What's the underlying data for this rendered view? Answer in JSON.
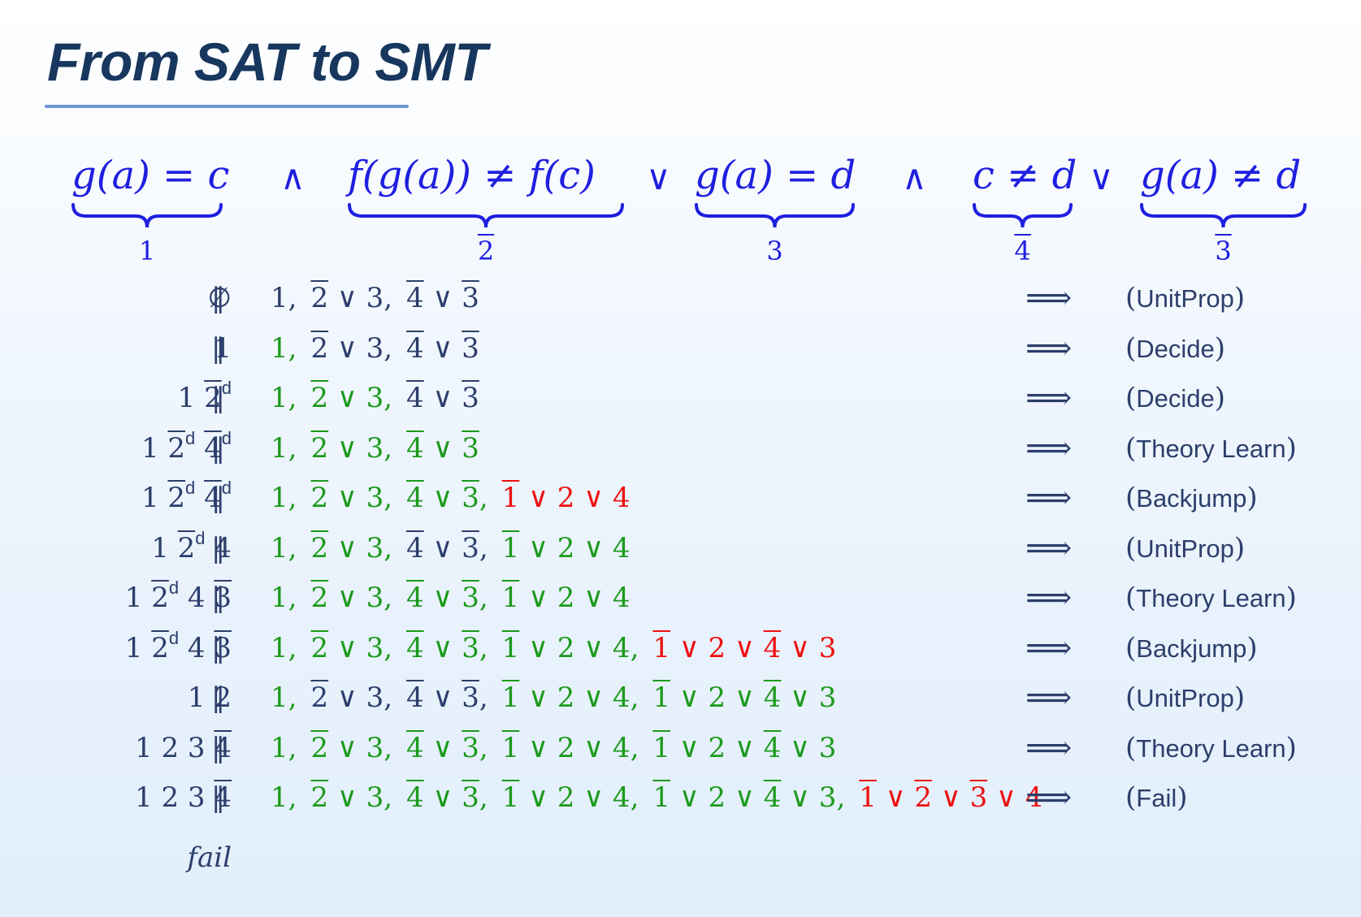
{
  "title": "From SAT to SMT",
  "formula": {
    "segments": [
      {
        "tex": "g(a) = c",
        "label": "1",
        "label_bar": false
      },
      {
        "tex": "f(g(a)) ≠ f(c)",
        "label": "2",
        "label_bar": true
      },
      {
        "tex": "g(a) = d",
        "label": "3",
        "label_bar": false
      },
      {
        "tex": "c ≠ d",
        "label": "4",
        "label_bar": true
      },
      {
        "tex": "g(a) ≠ d",
        "label": "3",
        "label_bar": true
      }
    ],
    "operators": [
      "∧",
      "∨",
      "∧",
      "∨"
    ]
  },
  "separator": "‖",
  "arrow": "⟹",
  "rows": [
    {
      "trail": [
        {
          "t": "∅"
        }
      ],
      "clauses": [
        {
          "c": "base",
          "p": [
            {
              "t": "1"
            }
          ]
        },
        {
          "c": "base",
          "p": [
            {
              "t": "2",
              "bar": true
            },
            {
              "t": " ∨ 3"
            }
          ]
        },
        {
          "c": "base",
          "p": [
            {
              "t": "4",
              "bar": true
            },
            {
              "t": " ∨ "
            },
            {
              "t": "3",
              "bar": true
            }
          ]
        }
      ],
      "rule": "UnitProp"
    },
    {
      "trail": [
        {
          "t": "1"
        }
      ],
      "clauses": [
        {
          "c": "green",
          "p": [
            {
              "t": "1"
            }
          ]
        },
        {
          "c": "base",
          "p": [
            {
              "t": "2",
              "bar": true
            },
            {
              "t": " ∨ 3"
            }
          ]
        },
        {
          "c": "base",
          "p": [
            {
              "t": "4",
              "bar": true
            },
            {
              "t": " ∨ "
            },
            {
              "t": "3",
              "bar": true
            }
          ]
        }
      ],
      "rule": "Decide"
    },
    {
      "trail": [
        {
          "t": "1 "
        },
        {
          "t": "2",
          "bar": true,
          "d": true
        }
      ],
      "clauses": [
        {
          "c": "green",
          "p": [
            {
              "t": "1"
            }
          ]
        },
        {
          "c": "green",
          "p": [
            {
              "t": "2",
              "bar": true
            },
            {
              "t": " ∨ 3"
            }
          ]
        },
        {
          "c": "base",
          "p": [
            {
              "t": "4",
              "bar": true
            },
            {
              "t": " ∨ "
            },
            {
              "t": "3",
              "bar": true
            }
          ]
        }
      ],
      "rule": "Decide"
    },
    {
      "trail": [
        {
          "t": "1 "
        },
        {
          "t": "2",
          "bar": true,
          "d": true
        },
        {
          "t": " "
        },
        {
          "t": "4",
          "bar": true,
          "d": true
        }
      ],
      "clauses": [
        {
          "c": "green",
          "p": [
            {
              "t": "1"
            }
          ]
        },
        {
          "c": "green",
          "p": [
            {
              "t": "2",
              "bar": true
            },
            {
              "t": " ∨ 3"
            }
          ]
        },
        {
          "c": "green",
          "p": [
            {
              "t": "4",
              "bar": true
            },
            {
              "t": " ∨ "
            },
            {
              "t": "3",
              "bar": true
            }
          ]
        }
      ],
      "rule": "Theory Learn"
    },
    {
      "trail": [
        {
          "t": "1 "
        },
        {
          "t": "2",
          "bar": true,
          "d": true
        },
        {
          "t": " "
        },
        {
          "t": "4",
          "bar": true,
          "d": true
        }
      ],
      "clauses": [
        {
          "c": "green",
          "p": [
            {
              "t": "1"
            }
          ]
        },
        {
          "c": "green",
          "p": [
            {
              "t": "2",
              "bar": true
            },
            {
              "t": " ∨ 3"
            }
          ]
        },
        {
          "c": "green",
          "p": [
            {
              "t": "4",
              "bar": true
            },
            {
              "t": " ∨ "
            },
            {
              "t": "3",
              "bar": true
            }
          ]
        },
        {
          "c": "red",
          "p": [
            {
              "t": "1",
              "bar": true
            },
            {
              "t": " ∨ 2 ∨ 4"
            }
          ]
        }
      ],
      "rule": "Backjump"
    },
    {
      "trail": [
        {
          "t": "1 "
        },
        {
          "t": "2",
          "bar": true,
          "d": true
        },
        {
          "t": " 4"
        }
      ],
      "clauses": [
        {
          "c": "green",
          "p": [
            {
              "t": "1"
            }
          ]
        },
        {
          "c": "green",
          "p": [
            {
              "t": "2",
              "bar": true
            },
            {
              "t": " ∨ 3"
            }
          ]
        },
        {
          "c": "base",
          "p": [
            {
              "t": "4",
              "bar": true
            },
            {
              "t": " ∨ "
            },
            {
              "t": "3",
              "bar": true
            }
          ]
        },
        {
          "c": "green",
          "p": [
            {
              "t": "1",
              "bar": true
            },
            {
              "t": " ∨ 2 ∨ 4"
            }
          ]
        }
      ],
      "rule": "UnitProp"
    },
    {
      "trail": [
        {
          "t": "1 "
        },
        {
          "t": "2",
          "bar": true,
          "d": true
        },
        {
          "t": " 4 "
        },
        {
          "t": "3",
          "bar": true
        }
      ],
      "clauses": [
        {
          "c": "green",
          "p": [
            {
              "t": "1"
            }
          ]
        },
        {
          "c": "green",
          "p": [
            {
              "t": "2",
              "bar": true
            },
            {
              "t": " ∨ 3"
            }
          ]
        },
        {
          "c": "green",
          "p": [
            {
              "t": "4",
              "bar": true
            },
            {
              "t": " ∨ "
            },
            {
              "t": "3",
              "bar": true
            }
          ]
        },
        {
          "c": "green",
          "p": [
            {
              "t": "1",
              "bar": true
            },
            {
              "t": " ∨ 2 ∨ 4"
            }
          ]
        }
      ],
      "rule": "Theory Learn"
    },
    {
      "trail": [
        {
          "t": "1 "
        },
        {
          "t": "2",
          "bar": true,
          "d": true
        },
        {
          "t": " 4 "
        },
        {
          "t": "3",
          "bar": true
        }
      ],
      "clauses": [
        {
          "c": "green",
          "p": [
            {
              "t": "1"
            }
          ]
        },
        {
          "c": "green",
          "p": [
            {
              "t": "2",
              "bar": true
            },
            {
              "t": " ∨ 3"
            }
          ]
        },
        {
          "c": "green",
          "p": [
            {
              "t": "4",
              "bar": true
            },
            {
              "t": " ∨ "
            },
            {
              "t": "3",
              "bar": true
            }
          ]
        },
        {
          "c": "green",
          "p": [
            {
              "t": "1",
              "bar": true
            },
            {
              "t": " ∨ 2 ∨ 4"
            }
          ]
        },
        {
          "c": "red",
          "p": [
            {
              "t": "1",
              "bar": true
            },
            {
              "t": " ∨ 2 ∨ "
            },
            {
              "t": "4",
              "bar": true
            },
            {
              "t": " ∨ 3"
            }
          ]
        }
      ],
      "rule": "Backjump"
    },
    {
      "trail": [
        {
          "t": "1 2"
        }
      ],
      "clauses": [
        {
          "c": "green",
          "p": [
            {
              "t": "1"
            }
          ]
        },
        {
          "c": "base",
          "p": [
            {
              "t": "2",
              "bar": true
            },
            {
              "t": " ∨ 3"
            }
          ]
        },
        {
          "c": "base",
          "p": [
            {
              "t": "4",
              "bar": true
            },
            {
              "t": " ∨ "
            },
            {
              "t": "3",
              "bar": true
            }
          ]
        },
        {
          "c": "green",
          "p": [
            {
              "t": "1",
              "bar": true
            },
            {
              "t": " ∨ 2 ∨ 4"
            }
          ]
        },
        {
          "c": "green",
          "p": [
            {
              "t": "1",
              "bar": true
            },
            {
              "t": " ∨ 2 ∨ "
            },
            {
              "t": "4",
              "bar": true
            },
            {
              "t": " ∨ 3"
            }
          ]
        }
      ],
      "rule": "UnitProp"
    },
    {
      "trail": [
        {
          "t": "1 2 3 "
        },
        {
          "t": "4",
          "bar": true
        }
      ],
      "clauses": [
        {
          "c": "green",
          "p": [
            {
              "t": "1"
            }
          ]
        },
        {
          "c": "green",
          "p": [
            {
              "t": "2",
              "bar": true
            },
            {
              "t": " ∨ 3"
            }
          ]
        },
        {
          "c": "green",
          "p": [
            {
              "t": "4",
              "bar": true
            },
            {
              "t": " ∨ "
            },
            {
              "t": "3",
              "bar": true
            }
          ]
        },
        {
          "c": "green",
          "p": [
            {
              "t": "1",
              "bar": true
            },
            {
              "t": " ∨ 2 ∨ 4"
            }
          ]
        },
        {
          "c": "green",
          "p": [
            {
              "t": "1",
              "bar": true
            },
            {
              "t": " ∨ 2 ∨ "
            },
            {
              "t": "4",
              "bar": true
            },
            {
              "t": " ∨ 3"
            }
          ]
        }
      ],
      "rule": "Theory Learn"
    },
    {
      "trail": [
        {
          "t": "1 2 3 "
        },
        {
          "t": "4",
          "bar": true
        }
      ],
      "clauses": [
        {
          "c": "green",
          "p": [
            {
              "t": "1"
            }
          ]
        },
        {
          "c": "green",
          "p": [
            {
              "t": "2",
              "bar": true
            },
            {
              "t": " ∨ 3"
            }
          ]
        },
        {
          "c": "green",
          "p": [
            {
              "t": "4",
              "bar": true
            },
            {
              "t": " ∨ "
            },
            {
              "t": "3",
              "bar": true
            }
          ]
        },
        {
          "c": "green",
          "p": [
            {
              "t": "1",
              "bar": true
            },
            {
              "t": " ∨ 2 ∨ 4"
            }
          ]
        },
        {
          "c": "green",
          "p": [
            {
              "t": "1",
              "bar": true
            },
            {
              "t": " ∨ 2 ∨ "
            },
            {
              "t": "4",
              "bar": true
            },
            {
              "t": " ∨ 3"
            }
          ]
        },
        {
          "c": "red",
          "p": [
            {
              "t": "1",
              "bar": true
            },
            {
              "t": " ∨ "
            },
            {
              "t": "2",
              "bar": true
            },
            {
              "t": " ∨ "
            },
            {
              "t": "3",
              "bar": true
            },
            {
              "t": " ∨ 4"
            }
          ]
        }
      ],
      "rule": "Fail"
    }
  ],
  "final": "fail",
  "colors": {
    "title": "#17375e",
    "formula": "#1f1fe0",
    "text": "#2c3e6b",
    "satisfied": "#1c9a1c",
    "learned": "#ee1111",
    "rule_line": "#6d96d6"
  }
}
